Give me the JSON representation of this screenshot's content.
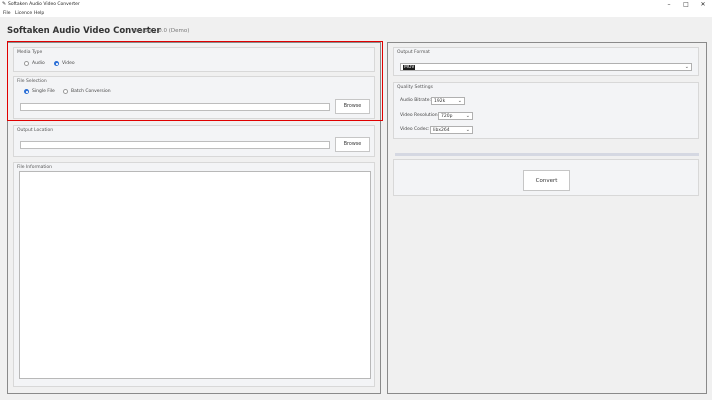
{
  "window": {
    "title": "Softaken Audio Video Converter"
  },
  "menu": {
    "items": [
      "File",
      "Licence",
      "Help"
    ]
  },
  "header": {
    "title": "Softaken Audio Video Converter",
    "version": "Version 1.0.0 (Demo)"
  },
  "media_type": {
    "label": "Media Type",
    "options": [
      {
        "label": "Audio",
        "selected": false
      },
      {
        "label": "Video",
        "selected": true
      }
    ]
  },
  "file_selection": {
    "label": "File Selection",
    "options": [
      {
        "label": "Single File",
        "selected": true
      },
      {
        "label": "Batch Conversion",
        "selected": false
      }
    ],
    "path_value": "",
    "browse_label": "Browse"
  },
  "output_location": {
    "label": "Output Location",
    "path_value": "",
    "browse_label": "Browse"
  },
  "file_information": {
    "label": "File Information",
    "content": ""
  },
  "output_format": {
    "label": "Output Format",
    "selected": "MOV"
  },
  "quality_settings": {
    "label": "Quality Settings",
    "audio_bitrate": {
      "label": "Audio Bitrate:",
      "value": "192k"
    },
    "video_resolution": {
      "label": "Video Resolution:",
      "value": "720p"
    },
    "video_codec": {
      "label": "Video Codec:",
      "value": "libx264"
    }
  },
  "progress": {
    "value": 0
  },
  "convert": {
    "label": "Convert"
  },
  "colors": {
    "highlight": "#e00000",
    "accent": "#2a6fd6"
  }
}
